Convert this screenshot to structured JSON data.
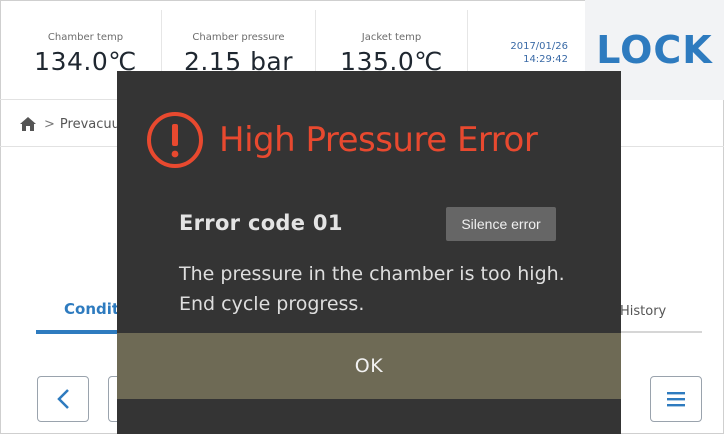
{
  "header": {
    "stats": [
      {
        "label": "Chamber temp",
        "value": "134.0℃"
      },
      {
        "label": "Chamber pressure",
        "value": "2.15 bar"
      },
      {
        "label": "Jacket temp",
        "value": "135.0℃"
      }
    ],
    "date": "2017/01/26",
    "time": "14:29:42",
    "lock_label": "LOCK"
  },
  "breadcrumb": {
    "icon": "home-icon",
    "separator": ">",
    "current": "Prevacuum"
  },
  "tabs": {
    "left_label": "Condition",
    "right_label": "History"
  },
  "nav": {
    "back_icon": "chevron-left-icon",
    "home_icon": "home-icon",
    "menu_icon": "hamburger-menu-icon"
  },
  "modal": {
    "title": "High Pressure Error",
    "icon": "warning-circle-icon",
    "title_color": "#e8492f",
    "error_code": "Error code 01",
    "silence_label": "Silence error",
    "message_line1": "The pressure in the chamber is too high.",
    "message_line2": "End cycle progress.",
    "ok_label": "OK"
  },
  "colors": {
    "accent": "#2e7bbf",
    "modal_bg": "#343434",
    "ok_bar": "#6e6a55"
  }
}
